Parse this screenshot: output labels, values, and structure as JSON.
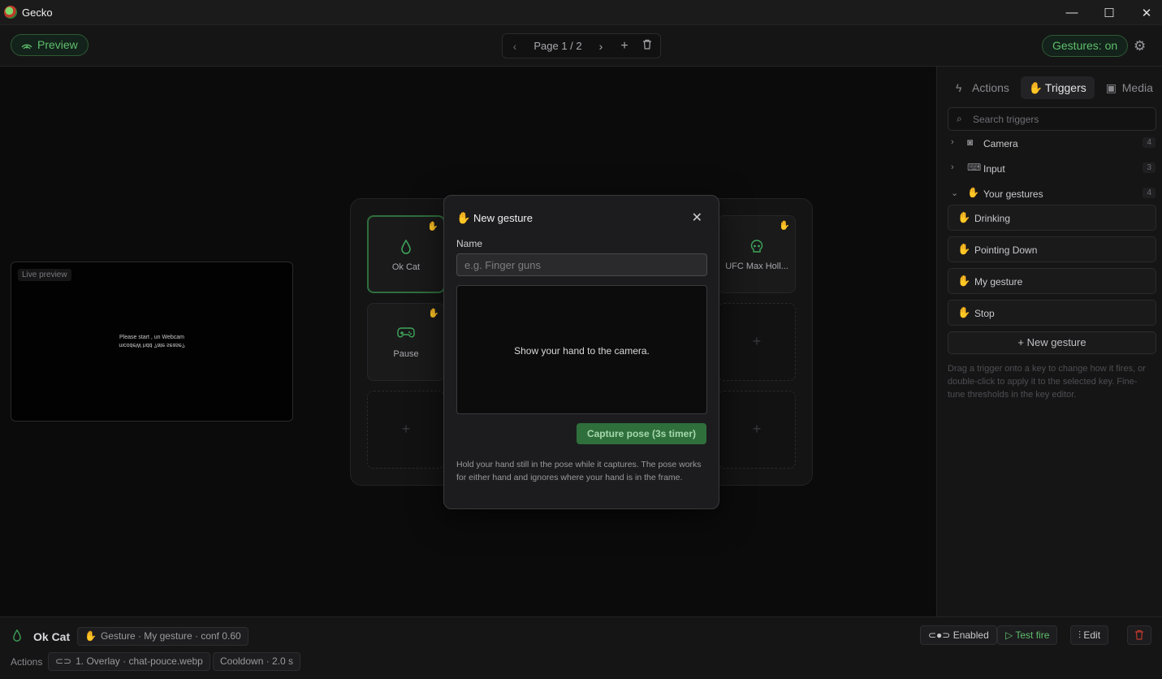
{
  "window": {
    "title": "Gecko",
    "minimize_glyph": "—",
    "maximize_glyph": "☐",
    "close_glyph": "✕"
  },
  "toolbar": {
    "preview_label": "Preview",
    "page_label": "Page 1 / 2",
    "gestures_label": "Gestures: on"
  },
  "live_preview": {
    "tag": "Live preview",
    "message_line1": "Please start , un Webcam",
    "message_line2": "mcodeW hdd  ?ate sease?"
  },
  "keys": [
    {
      "label": "Ok Cat",
      "icon": "droplet-icon",
      "selected": true
    },
    {
      "label": "UFC Max Holl...",
      "icon": "skull-icon"
    },
    {
      "label": "Pause",
      "icon": "gamepad-icon"
    }
  ],
  "modal": {
    "title": "New gesture",
    "name_label": "Name",
    "name_placeholder": "e.g. Finger guns",
    "camera_message": "Show your hand to the camera.",
    "capture_label": "Capture pose (3s timer)",
    "hint": "Hold your hand still in the pose while it captures. The pose works for either hand and ignores where your hand is in the frame."
  },
  "sidebar": {
    "tabs": [
      {
        "label": "Actions",
        "icon": "bolt-icon"
      },
      {
        "label": "Triggers",
        "icon": "hand-icon",
        "active": true
      },
      {
        "label": "Media",
        "icon": "image-icon"
      }
    ],
    "search_placeholder": "Search triggers",
    "categories": [
      {
        "label": "Camera",
        "count": "4",
        "icon": "camera-icon"
      },
      {
        "label": "Input",
        "count": "3",
        "icon": "keyboard-icon"
      },
      {
        "label": "Your gestures",
        "count": "4",
        "icon": "hand-icon"
      }
    ],
    "gestures": [
      "Drinking",
      "Pointing Down",
      "My gesture",
      "Stop"
    ],
    "new_gesture_label": "New gesture",
    "hint": "Drag a trigger onto a key to change how it fires, or double-click to apply it to the selected key. Fine-tune thresholds in the key editor."
  },
  "bottom": {
    "key_name": "Ok Cat",
    "trigger_chip": "Gesture · My gesture · conf 0.60",
    "actions_label": "Actions",
    "action_chip": "1. Overlay · chat-pouce.webp",
    "cooldown_chip": "Cooldown · 2.0 s",
    "enabled_label": "Enabled",
    "test_fire_label": "Test fire",
    "edit_label": "Edit"
  },
  "colors": {
    "accent_green": "#5fbf6d",
    "danger": "#c0392b"
  }
}
